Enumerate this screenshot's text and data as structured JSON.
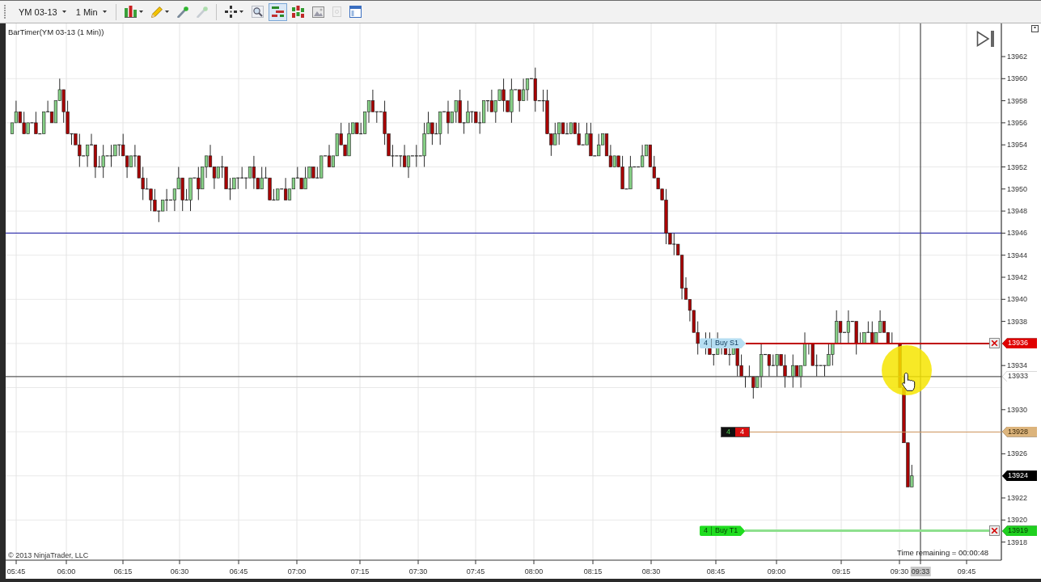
{
  "toolbar": {
    "instrument": "YM 03-13",
    "interval": "1 Min",
    "tool_groups": [
      [
        {
          "kind": "bars",
          "has_menu": true,
          "selected": false,
          "disabled": false
        },
        {
          "kind": "pencil",
          "has_menu": true,
          "selected": false,
          "disabled": false
        },
        {
          "kind": "pin",
          "has_menu": false,
          "selected": false,
          "disabled": false
        },
        {
          "kind": "pin",
          "has_menu": false,
          "selected": false,
          "disabled": true
        }
      ],
      [
        {
          "kind": "crosshair",
          "has_menu": true,
          "selected": false,
          "disabled": false
        },
        {
          "kind": "zoom",
          "has_menu": false,
          "selected": false,
          "disabled": false
        },
        {
          "kind": "trader",
          "has_menu": false,
          "selected": true,
          "disabled": false
        },
        {
          "kind": "candles",
          "has_menu": false,
          "selected": false,
          "disabled": false
        },
        {
          "kind": "image",
          "has_menu": false,
          "selected": false,
          "disabled": false
        },
        {
          "kind": "page",
          "has_menu": false,
          "selected": false,
          "disabled": true
        },
        {
          "kind": "window",
          "has_menu": false,
          "selected": false,
          "disabled": false
        }
      ]
    ]
  },
  "chart": {
    "indicator_label": "BarTimer(YM 03-13 (1 Min))",
    "orders": [
      {
        "kind": "stop",
        "quantity": "4",
        "label": "Buy S1",
        "price": "13936"
      },
      {
        "kind": "target",
        "quantity": "4",
        "label": "Buy T1",
        "price": "13919"
      }
    ],
    "position": {
      "quantity": "4",
      "value": "4",
      "price": "13928"
    },
    "price_markers": [
      {
        "kind": "crosshair",
        "price": "13933"
      },
      {
        "kind": "last",
        "price": "13924"
      }
    ],
    "price_axis": [
      "13962",
      "13960",
      "13958",
      "13956",
      "13954",
      "13952",
      "13950",
      "13948",
      "13946",
      "13944",
      "13942",
      "13940",
      "13938",
      "13934",
      "13930",
      "13926",
      "13922",
      "13920",
      "13918"
    ],
    "time_axis": [
      {
        "text": "05:45",
        "highlighted": false
      },
      {
        "text": "06:00",
        "highlighted": false
      },
      {
        "text": "06:15",
        "highlighted": false
      },
      {
        "text": "06:30",
        "highlighted": false
      },
      {
        "text": "06:45",
        "highlighted": false
      },
      {
        "text": "07:00",
        "highlighted": false
      },
      {
        "text": "07:15",
        "highlighted": false
      },
      {
        "text": "07:30",
        "highlighted": false
      },
      {
        "text": "07:45",
        "highlighted": false
      },
      {
        "text": "08:00",
        "highlighted": false
      },
      {
        "text": "08:15",
        "highlighted": false
      },
      {
        "text": "08:30",
        "highlighted": false
      },
      {
        "text": "08:45",
        "highlighted": false
      },
      {
        "text": "09:00",
        "highlighted": false
      },
      {
        "text": "09:15",
        "highlighted": false
      },
      {
        "text": "09:30",
        "highlighted": false
      },
      {
        "text": "09:33",
        "highlighted": true
      },
      {
        "text": "09:45",
        "highlighted": false
      }
    ],
    "timer": "Time remaining = 00:00:48",
    "copyright": "© 2013 NinjaTrader, LLC"
  }
}
